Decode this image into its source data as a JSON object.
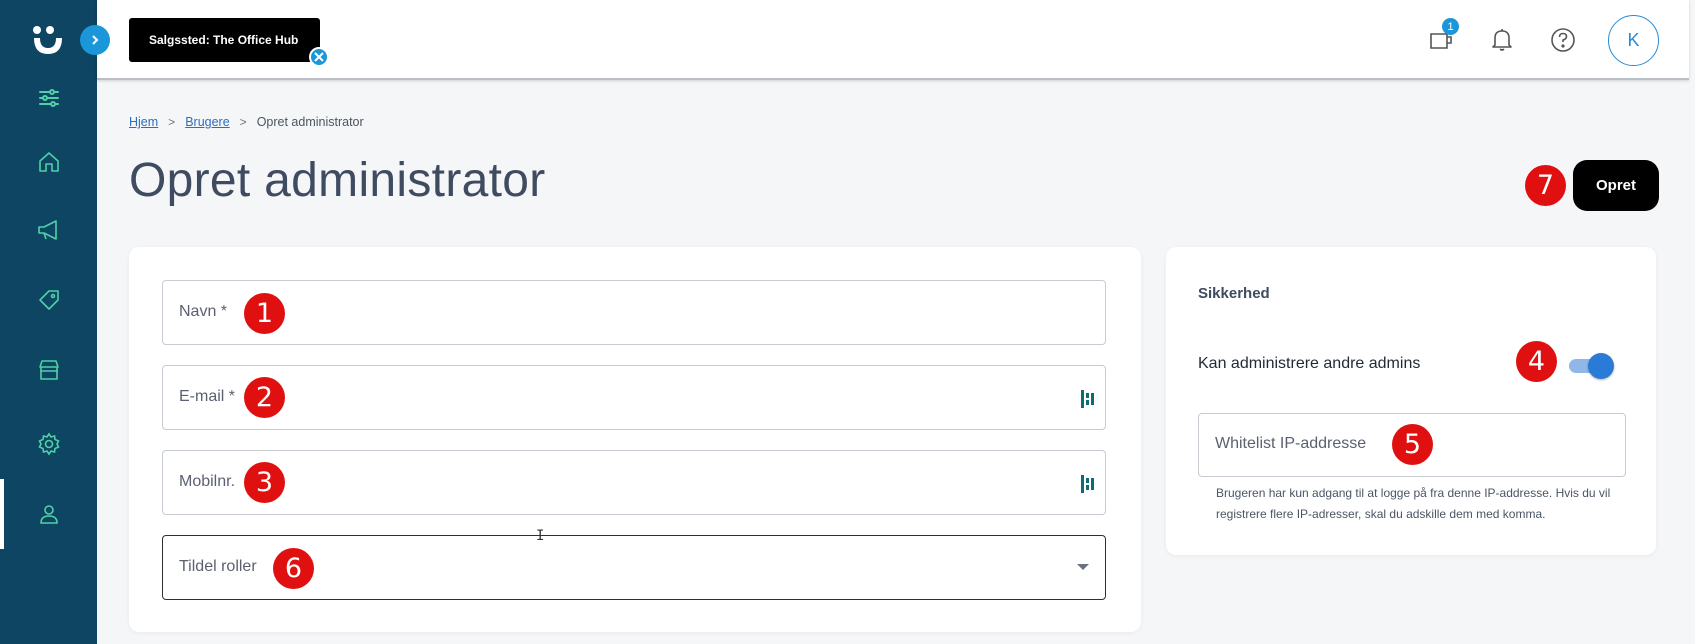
{
  "header": {
    "store_chip": "Salgssted: The Office Hub",
    "notification_count": "1",
    "avatar_initial": "K"
  },
  "sidebar": {
    "items": [
      {
        "icon": "sliders-icon"
      },
      {
        "icon": "home-icon"
      },
      {
        "icon": "megaphone-icon"
      },
      {
        "icon": "tag-icon"
      },
      {
        "icon": "store-icon"
      },
      {
        "icon": "gear-icon"
      },
      {
        "icon": "user-icon"
      }
    ]
  },
  "breadcrumb": {
    "home": "Hjem",
    "users": "Brugere",
    "current": "Opret administrator",
    "sep": ">"
  },
  "page": {
    "title": "Opret administrator",
    "create_label": "Opret"
  },
  "form": {
    "name_label": "Navn *",
    "email_label": "E-mail *",
    "mobile_label": "Mobilnr.",
    "roles_label": "Tildel roller"
  },
  "security": {
    "title": "Sikkerhed",
    "toggle_label": "Kan administrere andre admins",
    "toggle_on": true,
    "ip_label": "Whitelist IP-addresse",
    "helper": "Brugeren har kun adgang til at logge på fra denne IP-addresse. Hvis du vil registrere flere IP-adresser, skal du adskille dem med komma."
  },
  "markers": {
    "m1": "1",
    "m2": "2",
    "m3": "3",
    "m4": "4",
    "m5": "5",
    "m6": "6",
    "m7": "7"
  },
  "colors": {
    "sidebar": "#0d4563",
    "sidebar_icon": "#4fd1a5",
    "accent": "#1a96d9",
    "marker": "#e01010"
  }
}
